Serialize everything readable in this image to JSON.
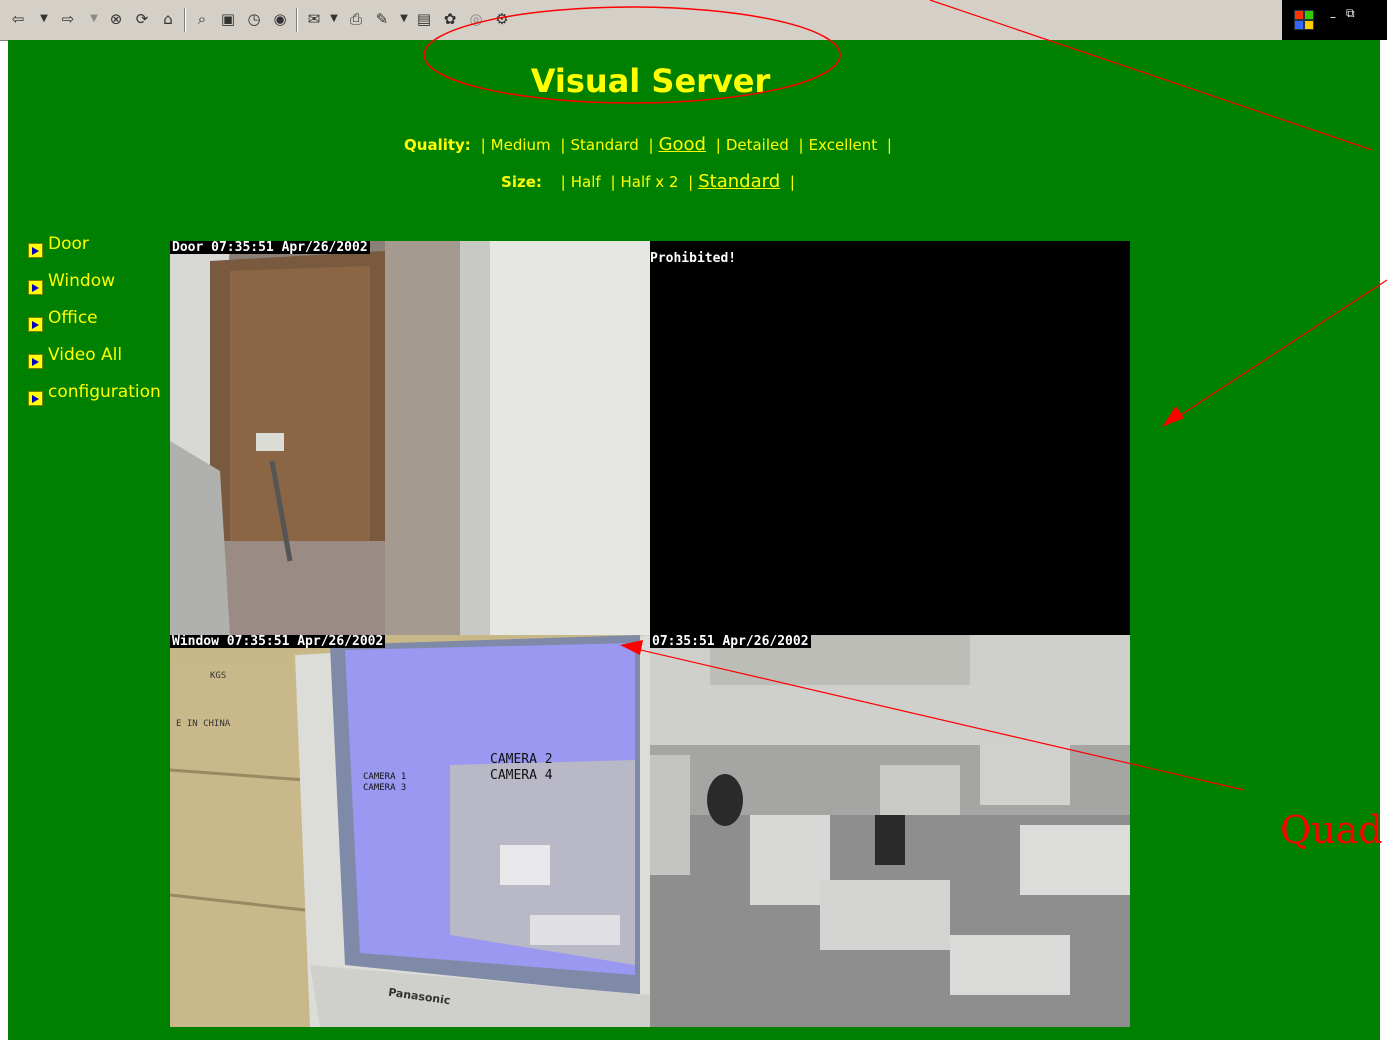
{
  "toolbar": {
    "buttons": [
      "back-icon",
      "dropdown-arrow-icon",
      "forward-icon",
      "dropdown-arrow-icon",
      "stop-icon",
      "refresh-icon",
      "home-icon",
      "search-icon",
      "favorites-icon",
      "history-icon",
      "media-icon",
      "mail-icon",
      "print-icon",
      "edit-icon",
      "dropdown-arrow-icon",
      "discuss-icon",
      "messenger-icon",
      "related-icon",
      "tools-icon"
    ]
  },
  "page": {
    "title": "Visual Server",
    "quality_label": "Quality:",
    "quality_options": [
      "Medium",
      "Standard",
      "Good",
      "Detailed",
      "Excellent"
    ],
    "quality_selected": "Good",
    "size_label": "Size:",
    "size_options": [
      "Half",
      "Half x 2",
      "Standard"
    ],
    "size_selected": "Standard"
  },
  "nav": {
    "items": [
      {
        "label": "Door"
      },
      {
        "label": "Window"
      },
      {
        "label": "Office"
      },
      {
        "label": "Video All"
      },
      {
        "label": "configuration"
      }
    ]
  },
  "cameras": {
    "door_stamp": "Door 07:35:51 Apr/26/2002",
    "prohibited": "Prohibited!",
    "window_stamp": "Window 07:35:51 Apr/26/2002",
    "office_stamp": "07:35:51 Apr/26/2002",
    "monitor_cam1": "CAMERA 1",
    "monitor_cam3": "CAMERA 3",
    "monitor_cam2": "CAMERA 2",
    "monitor_cam4": "CAMERA 4",
    "monitor_brand": "Panasonic",
    "box_text_1": "KGS",
    "box_text_2": "E IN CHINA"
  },
  "annotation": {
    "text": "Quad s",
    "color": "#ff0000"
  },
  "colors": {
    "background": "#008000",
    "text": "#ffff00",
    "annotation": "#ff0000"
  }
}
